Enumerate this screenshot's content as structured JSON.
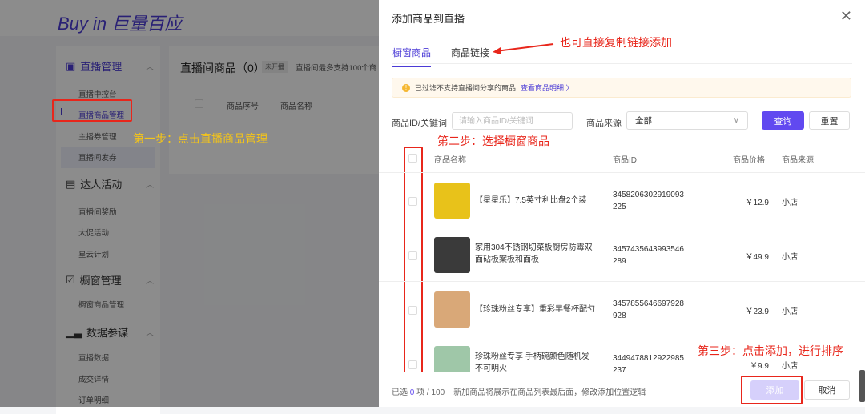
{
  "app": {
    "logo": "Buy in 巨量百应"
  },
  "sidebar": {
    "groups": [
      {
        "label": "直播管理",
        "icon": "live-icon",
        "items": [
          "直播中控台",
          "直播商品管理",
          "主播券管理",
          "直播间发券"
        ]
      },
      {
        "label": "达人活动",
        "icon": "activity-icon",
        "items": [
          "直播间奖励",
          "大促活动",
          "星云计划"
        ]
      },
      {
        "label": "橱窗管理",
        "icon": "window-icon",
        "items": [
          "橱窗商品管理"
        ]
      },
      {
        "label": "数据参谋",
        "icon": "chart-icon",
        "items": [
          "直播数据",
          "成交详情",
          "订单明细"
        ]
      }
    ]
  },
  "main": {
    "title": "直播间商品（0）",
    "status_badge": "未开播",
    "note": "直播间最多支持100个商",
    "columns": [
      "商品序号",
      "商品名称"
    ]
  },
  "drawer": {
    "title": "添加商品到直播",
    "tabs": [
      "橱窗商品",
      "商品链接"
    ],
    "notice": {
      "text": "已过滤不支持直播间分享的商品",
      "link": "查看商品明细 〉"
    },
    "filter": {
      "id_label": "商品ID/关键词",
      "id_placeholder": "请输入商品ID/关键词",
      "source_label": "商品来源",
      "source_value": "全部",
      "query": "查询",
      "reset": "重置"
    },
    "columns": [
      "商品名称",
      "商品ID",
      "商品价格",
      "商品来源"
    ],
    "rows": [
      {
        "name": "【星星乐】7.5英寸利比盘2个装",
        "id": "3458206302919093225",
        "price": "￥12.9",
        "source": "小店",
        "thumb": "#e8c21a"
      },
      {
        "name": "家用304不锈钢切菜板厨房防霉双面砧板案板和面板",
        "id": "3457435643993546289",
        "price": "￥49.9",
        "source": "小店",
        "thumb": "#3a3a3a"
      },
      {
        "name": "【珍珠粉丝专享】重彩早餐杯配勺",
        "id": "3457855646697928928",
        "price": "￥23.9",
        "source": "小店",
        "thumb": "#d9a878"
      },
      {
        "name": "珍珠粉丝专享 手柄碗颜色随机发不可明火",
        "id": "3449478812922985237",
        "price": "￥9.9",
        "source": "小店",
        "thumb": "#9fc7a8"
      }
    ],
    "footer": {
      "selected_prefix": "已选 ",
      "selected_count": "0",
      "selected_suffix": " 项 / 100",
      "hint": "新加商品将展示在商品列表最后面，修改添加位置逻辑",
      "add": "添加",
      "cancel": "取消"
    }
  },
  "annotations": {
    "step1": "第一步：点击直播商品管理",
    "step2": "第二步：选择橱窗商品",
    "step3": "第三步：点击添加，进行排序",
    "link_hint": "也可直接复制链接添加"
  }
}
